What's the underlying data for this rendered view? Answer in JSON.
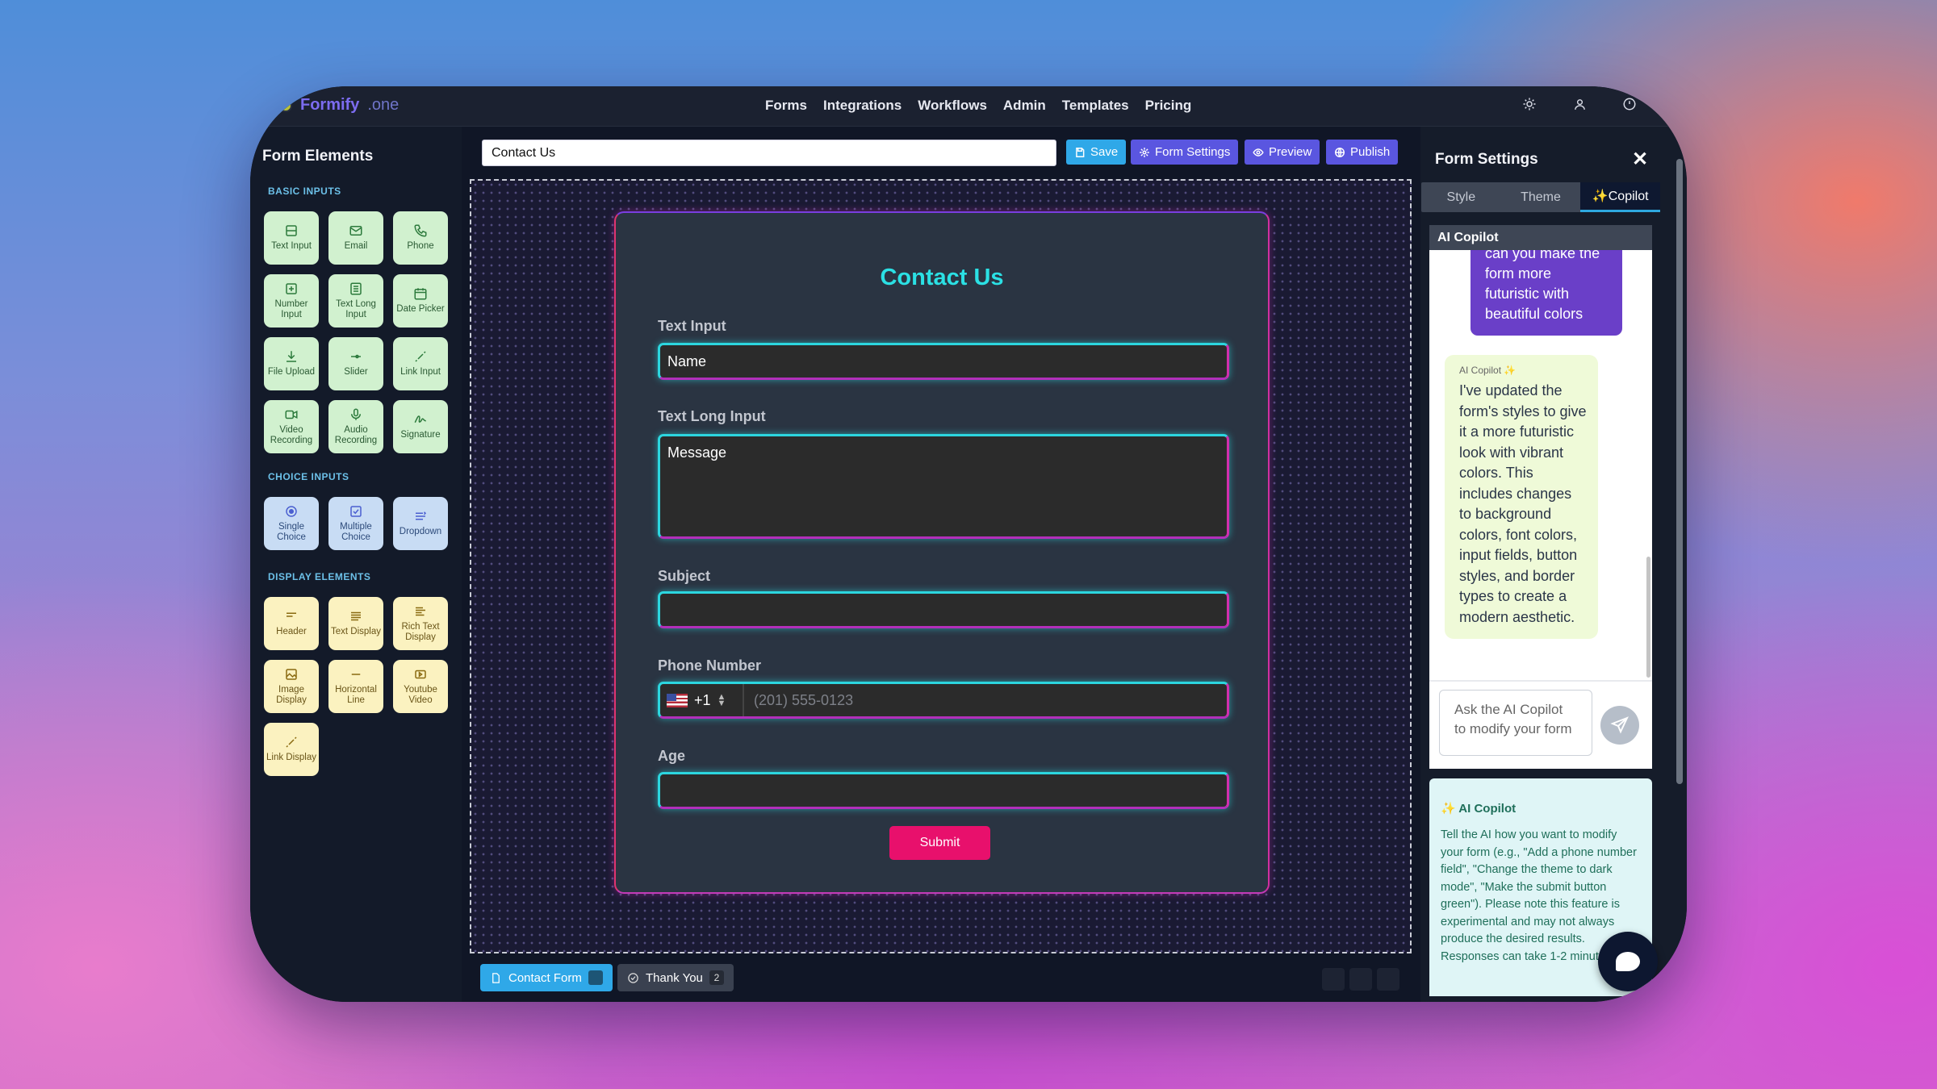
{
  "app": {
    "name": "Formify",
    "suffix": ".one"
  },
  "nav": [
    "Forms",
    "Integrations",
    "Workflows",
    "Admin",
    "Templates",
    "Pricing"
  ],
  "top_icons": [
    "sun-icon",
    "user-icon",
    "power-icon"
  ],
  "left_panel": {
    "title": "Form Elements",
    "sections": [
      {
        "title": "BASIC INPUTS",
        "items": [
          "Text Input",
          "Email",
          "Phone",
          "Number Input",
          "Text Long Input",
          "Date Picker",
          "File Upload",
          "Slider",
          "Link Input",
          "Video Recording",
          "Audio Recording",
          "Signature"
        ]
      },
      {
        "title": "CHOICE INPUTS",
        "items": [
          "Single Choice",
          "Multiple Choice",
          "Dropdown"
        ]
      },
      {
        "title": "DISPLAY ELEMENTS",
        "items": [
          "Header",
          "Text Display",
          "Rich Text Display",
          "Image Display",
          "Horizontal Line",
          "Youtube Video",
          "Link Display"
        ]
      }
    ]
  },
  "toolbar": {
    "form_name": "Contact Us",
    "save": "Save",
    "form_settings": "Form Settings",
    "preview": "Preview",
    "publish": "Publish"
  },
  "form": {
    "title": "Contact Us",
    "fields": [
      {
        "label": "Text Input",
        "value": "Name"
      },
      {
        "label": "Text Long Input",
        "value": "Message"
      },
      {
        "label": "Subject",
        "value": ""
      },
      {
        "label": "Phone Number",
        "country_code": "+1",
        "placeholder": "(201) 555-0123"
      },
      {
        "label": "Age",
        "value": ""
      }
    ],
    "submit": "Submit"
  },
  "page_tabs": [
    {
      "label": "Contact Form",
      "badge": ""
    },
    {
      "label": "Thank You",
      "badge": "2"
    }
  ],
  "right_panel": {
    "title": "Form Settings",
    "close": "✕",
    "tabs": [
      "Style",
      "Theme",
      "✨Copilot"
    ],
    "ai_header": "AI Copilot",
    "user_message": "can you make the form more futuristic with beautiful colors",
    "ai_sender": "AI Copilot ✨",
    "ai_message": "I've updated the form's styles to give it a more futuristic look with vibrant colors. This includes changes to background colors, font colors, input fields, button styles, and border types to create a modern aesthetic.",
    "input_placeholder": "Ask the AI Copilot to modify your form",
    "info_title": "✨ AI Copilot",
    "info_text": "Tell the AI how you want to modify your form (e.g., \"Add a phone number field\", \"Change the theme to dark mode\", \"Make the submit button green\"). Please note this feature is experimental and may not always produce the desired results. Responses can take 1-2 minutes."
  },
  "colors": {
    "accent_cyan": "#2be0e4",
    "submit_pink": "#e8106c",
    "brand_purple": "#7c6cf0",
    "save_blue": "#2fa8e8",
    "settings_purple": "#5a56e0"
  }
}
